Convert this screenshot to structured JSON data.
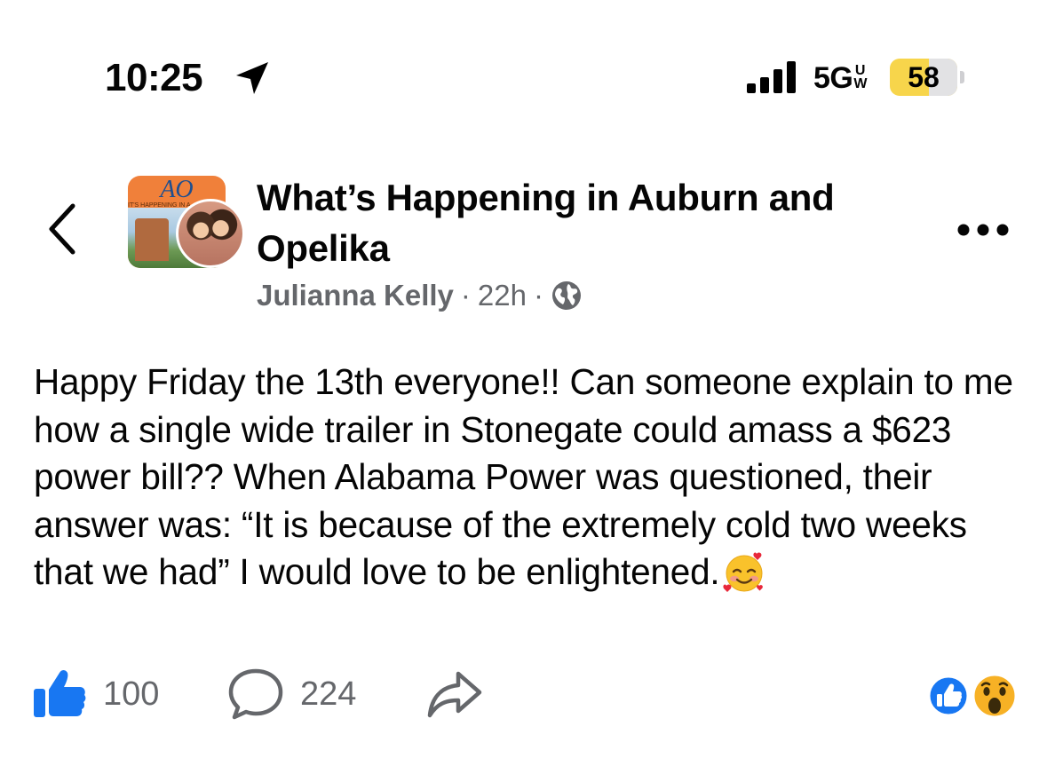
{
  "status_bar": {
    "time": "10:25",
    "network": "5G",
    "network_sup": "UW",
    "battery_level": "58",
    "battery_fraction": 0.58
  },
  "header": {
    "back_icon": "chevron-left-icon",
    "group_avatar_text": "AO",
    "group_avatar_tag": "IT'S HAPPENING IN A",
    "group_name": "What’s Happening in Auburn and Opelika",
    "author": "Julianna Kelly",
    "time_ago": "22h",
    "separator": "·",
    "privacy_icon": "globe-icon",
    "more_icon": "more-horizontal-icon"
  },
  "post": {
    "text": "Happy Friday the 13th everyone!! Can someone explain to me how a single wide trailer in Stonegate could amass a $623 power bill?? When Alabama Power was questioned, their answer was: “It is because of the extremely cold two weeks that we had” I would love to be enlightened.",
    "emoji": "smiling-face-with-hearts"
  },
  "actions": {
    "like_count": "100",
    "comment_count": "224",
    "like_icon": "thumbs-up-icon",
    "comment_icon": "comment-bubble-icon",
    "share_icon": "share-arrow-icon",
    "reactions": [
      "like",
      "wow"
    ]
  },
  "colors": {
    "text_primary": "#050505",
    "text_secondary": "#65676b",
    "facebook_blue": "#1877f2",
    "battery_yellow": "#f7d54b"
  }
}
